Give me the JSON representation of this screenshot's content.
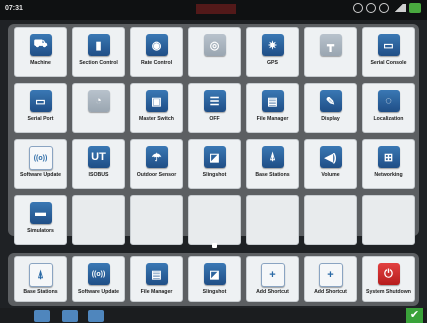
{
  "status": {
    "time": "07:31"
  },
  "grid": [
    {
      "label": "Machine",
      "icon": "tractor-icon",
      "glyph": "⛟",
      "disabled": false,
      "style": ""
    },
    {
      "label": "Section Control",
      "icon": "section-control-icon",
      "glyph": "▮",
      "disabled": false,
      "style": ""
    },
    {
      "label": "Rate Control",
      "icon": "rate-control-icon",
      "glyph": "◉",
      "disabled": false,
      "style": ""
    },
    {
      "label": "",
      "icon": "steering-wheel-icon",
      "glyph": "◎",
      "disabled": true,
      "style": "dis"
    },
    {
      "label": "GPS",
      "icon": "satellite-icon",
      "glyph": "✷",
      "disabled": false,
      "style": ""
    },
    {
      "label": "",
      "icon": "implement-icon",
      "glyph": "┳",
      "disabled": true,
      "style": "dis"
    },
    {
      "label": "Serial Console",
      "icon": "serial-console-icon",
      "glyph": "▭",
      "disabled": false,
      "style": ""
    },
    {
      "label": "Serial Port",
      "icon": "serial-port-icon",
      "glyph": "▭",
      "disabled": false,
      "style": ""
    },
    {
      "label": "",
      "icon": "gauge-icon",
      "glyph": "◔",
      "disabled": true,
      "style": "dis"
    },
    {
      "label": "Master Switch",
      "icon": "master-switch-icon",
      "glyph": "▣",
      "disabled": false,
      "style": ""
    },
    {
      "label": "OFF",
      "icon": "list-icon",
      "glyph": "☰",
      "disabled": false,
      "style": ""
    },
    {
      "label": "File Manager",
      "icon": "file-manager-icon",
      "glyph": "▤",
      "disabled": false,
      "style": ""
    },
    {
      "label": "Display",
      "icon": "display-icon",
      "glyph": "✎",
      "disabled": false,
      "style": ""
    },
    {
      "label": "Localization",
      "icon": "localization-icon",
      "glyph": "◌",
      "disabled": false,
      "style": ""
    },
    {
      "label": "Software Update",
      "icon": "software-update-icon",
      "glyph": "((o))",
      "disabled": false,
      "style": "light"
    },
    {
      "label": "ISOBUS",
      "icon": "isobus-icon",
      "glyph": "UT",
      "disabled": false,
      "style": ""
    },
    {
      "label": "Outdoor Sensor",
      "icon": "outdoor-sensor-icon",
      "glyph": "☂",
      "disabled": false,
      "style": ""
    },
    {
      "label": "Slingshot",
      "icon": "slingshot-icon",
      "glyph": "◪",
      "disabled": false,
      "style": ""
    },
    {
      "label": "Base Stations",
      "icon": "antenna-icon",
      "glyph": "⍋",
      "disabled": false,
      "style": ""
    },
    {
      "label": "Volume",
      "icon": "volume-icon",
      "glyph": "◀)",
      "disabled": false,
      "style": ""
    },
    {
      "label": "Networking",
      "icon": "network-icon",
      "glyph": "⊞",
      "disabled": false,
      "style": ""
    },
    {
      "label": "Simulators",
      "icon": "simulator-icon",
      "glyph": "▬",
      "disabled": false,
      "style": ""
    },
    {
      "label": "",
      "icon": "",
      "glyph": "",
      "disabled": false,
      "style": "empty"
    },
    {
      "label": "",
      "icon": "",
      "glyph": "",
      "disabled": false,
      "style": "empty"
    },
    {
      "label": "",
      "icon": "",
      "glyph": "",
      "disabled": false,
      "style": "empty"
    },
    {
      "label": "",
      "icon": "",
      "glyph": "",
      "disabled": false,
      "style": "empty"
    },
    {
      "label": "",
      "icon": "",
      "glyph": "",
      "disabled": false,
      "style": "empty"
    },
    {
      "label": "",
      "icon": "",
      "glyph": "",
      "disabled": false,
      "style": "empty"
    }
  ],
  "dock": [
    {
      "label": "Base Stations",
      "icon": "antenna-icon",
      "glyph": "⍋",
      "style": "light"
    },
    {
      "label": "Software Update",
      "icon": "software-update-icon",
      "glyph": "((o))",
      "style": ""
    },
    {
      "label": "File Manager",
      "icon": "file-manager-icon",
      "glyph": "▤",
      "style": ""
    },
    {
      "label": "Slingshot",
      "icon": "slingshot-icon",
      "glyph": "◪",
      "style": ""
    },
    {
      "label": "Add Shortcut",
      "icon": "plus-icon",
      "glyph": "+",
      "style": "light"
    },
    {
      "label": "Add Shortcut",
      "icon": "plus-icon",
      "glyph": "+",
      "style": "light"
    },
    {
      "label": "System Shutdown",
      "icon": "power-icon",
      "glyph": "⏻",
      "style": "red"
    }
  ],
  "colors": {
    "accent": "#2f6aa8",
    "panel": "#5c5f62",
    "ok": "#3aa23a"
  }
}
